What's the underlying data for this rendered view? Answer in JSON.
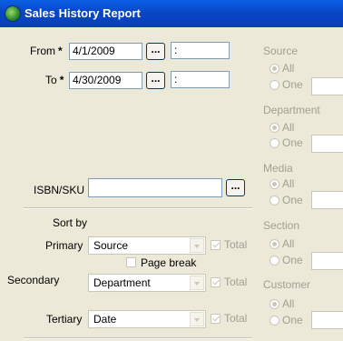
{
  "window": {
    "title": "Sales History Report",
    "icon": "globe-icon"
  },
  "dates": {
    "from_label": "From",
    "to_label": "To",
    "required_marker": "*",
    "from_value": "4/1/2009",
    "to_value": "4/30/2009",
    "from_time": ":",
    "to_time": ":",
    "browse_label": "..."
  },
  "isbn": {
    "label": "ISBN/SKU",
    "value": "",
    "browse_label": "..."
  },
  "sort": {
    "heading": "Sort by",
    "primary_label": "Primary",
    "secondary_label": "Secondary",
    "tertiary_label": "Tertiary",
    "primary_value": "Source",
    "secondary_value": "Department",
    "tertiary_value": "Date",
    "total_label": "Total",
    "page_break_label": "Page break"
  },
  "filters": {
    "source": "Source",
    "department": "Department",
    "media": "Media",
    "section": "Section",
    "customer": "Customer",
    "all_label": "All",
    "one_label": "One"
  }
}
